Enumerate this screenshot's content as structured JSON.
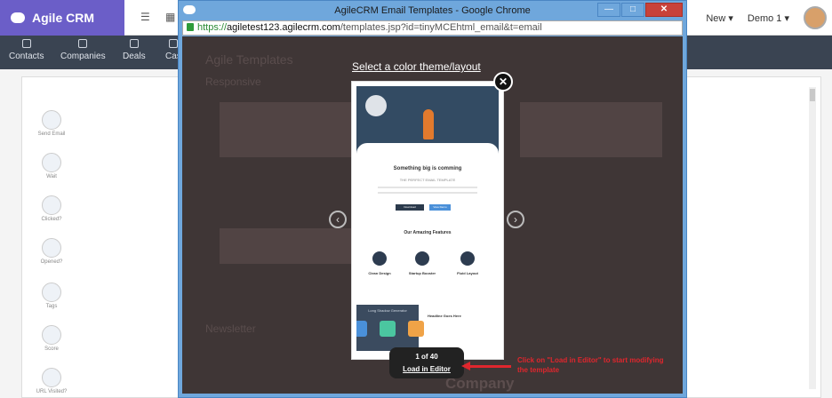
{
  "crm": {
    "brand": "Agile CRM",
    "top_right": {
      "new_label": "New ▾",
      "user_label": "Demo 1 ▾"
    },
    "nav": [
      {
        "label": "Contacts",
        "icon": "person-icon"
      },
      {
        "label": "Companies",
        "icon": "building-icon"
      },
      {
        "label": "Deals",
        "icon": "money-icon"
      },
      {
        "label": "Cas",
        "icon": "folder-icon"
      }
    ],
    "side_tools": [
      "Send Email",
      "Wait",
      "Clicked?",
      "Opened?",
      "Tags",
      "Score",
      "URL Visited?"
    ]
  },
  "chrome": {
    "title": "AgileCRM Email Templates - Google Chrome",
    "url_scheme": "https://",
    "url_host": "agiletest123.agilecrm.com",
    "url_path": "/templates.jsp?id=tinyMCEhtml_email&t=email",
    "min_label": "—",
    "max_label": "□",
    "close_label": "✕"
  },
  "page_background": {
    "heading": "Agile Templates",
    "subheading": "Responsive",
    "section2": "Newsletter",
    "company": "Company"
  },
  "modal": {
    "title": "Select a color theme/layout",
    "close": "✕",
    "prev": "‹",
    "next": "›",
    "counter": "1 of 40",
    "load_label": "Load in Editor",
    "annotation": "Click on \"Load in Editor\" to start modifying the template"
  },
  "preview": {
    "headline": "Something big is comming",
    "subheadline": "THE PERFECT EMAIL TEMPLATE",
    "btn1": "Download",
    "btn2": "View Demo",
    "features_title": "Our Amazing Features",
    "features": [
      "Clean Design",
      "Startup Booster",
      "Fluid Layout"
    ],
    "dark_title": "Long Shadow Generator",
    "side_headline": "Headline Goes Here"
  },
  "colors": {
    "brand": "#6b5ec8",
    "nav": "#3a4452",
    "accent_red": "#e0262d",
    "chrome": "#6fa7dc"
  }
}
